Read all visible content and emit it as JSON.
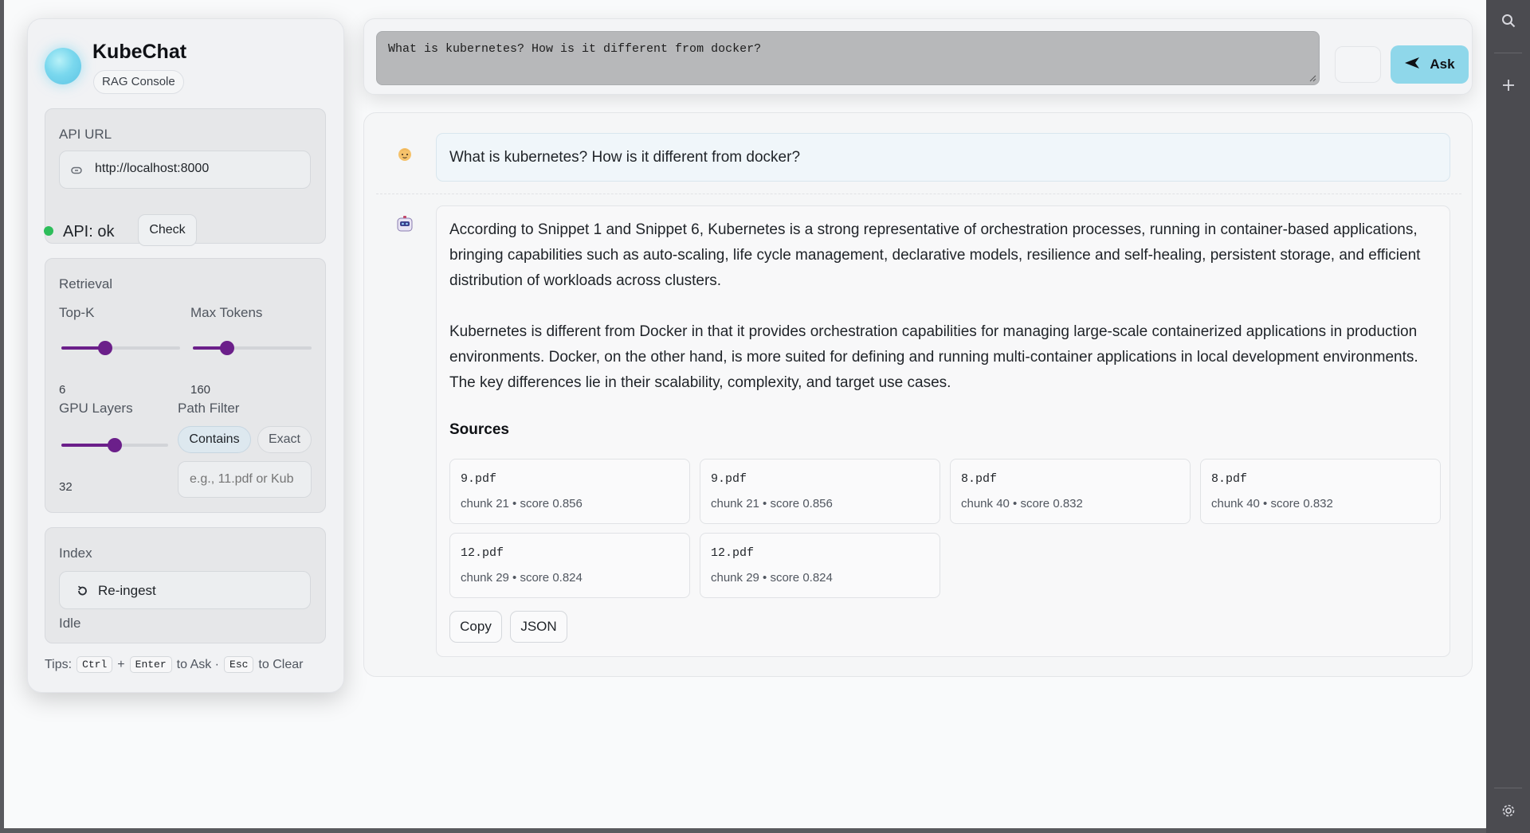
{
  "app": {
    "title": "KubeChat",
    "subtitle": "RAG Console"
  },
  "api": {
    "label": "API URL",
    "url": "http://localhost:8000",
    "status_text": "API: ok",
    "status_color": "#2dbd5a",
    "check_label": "Check"
  },
  "retrieval": {
    "title": "Retrieval",
    "top_k": {
      "label": "Top-K",
      "value": "6",
      "fraction": 0.35
    },
    "max_tokens": {
      "label": "Max Tokens",
      "value": "160",
      "fraction": 0.26
    },
    "gpu_layers": {
      "label": "GPU Layers",
      "value": "32",
      "fraction": 0.5
    },
    "path_filter": {
      "label": "Path Filter",
      "modes": [
        "Contains",
        "Exact"
      ],
      "active_mode": "Contains",
      "placeholder": "e.g., 11.pdf or Kub"
    }
  },
  "index": {
    "title": "Index",
    "reingest_label": "Re-ingest",
    "status": "Idle"
  },
  "tips": {
    "prefix": "Tips:",
    "key_ctrl": "Ctrl",
    "plus": "+",
    "key_enter": "Enter",
    "ask_text": "to Ask ·",
    "key_esc": "Esc",
    "clear_text": "to Clear"
  },
  "query": {
    "text": "What is kubernetes? How is it different from docker?",
    "ask_label": "Ask"
  },
  "chat": {
    "user_message": "What is kubernetes? How is it different from docker?",
    "answer_paragraphs": [
      "According to Snippet 1 and Snippet 6, Kubernetes is a strong representative of orchestration processes, running in container-based applications, bringing capabilities such as auto-scaling, life cycle management, declarative models, resilience and self-healing, persistent storage, and efficient distribution of workloads across clusters.",
      "Kubernetes is different from Docker in that it provides orchestration capabilities for managing large-scale containerized applications in production environments. Docker, on the other hand, is more suited for defining and running multi-container applications in local development environments. The key differences lie in their scalability, complexity, and target use cases."
    ],
    "sources_title": "Sources",
    "sources": [
      {
        "file": "9.pdf",
        "meta": "chunk 21 • score 0.856"
      },
      {
        "file": "9.pdf",
        "meta": "chunk 21 • score 0.856"
      },
      {
        "file": "8.pdf",
        "meta": "chunk 40 • score 0.832"
      },
      {
        "file": "8.pdf",
        "meta": "chunk 40 • score 0.832"
      },
      {
        "file": "12.pdf",
        "meta": "chunk 29 • score 0.824"
      },
      {
        "file": "12.pdf",
        "meta": "chunk 29 • score 0.824"
      }
    ],
    "copy_label": "Copy",
    "json_label": "JSON"
  },
  "icons": {
    "logo": "gradient-orb",
    "api_url": "link-icon",
    "reingest": "refresh-icon",
    "ask": "send-icon",
    "user_avatar": "person-emoji",
    "bot_avatar": "robot-emoji",
    "right_strip": [
      "search-icon",
      "plus-icon",
      "settings-icon"
    ]
  },
  "colors": {
    "accent": "#6b1f8a",
    "ask_button": "#8fd7ea",
    "status_ok": "#2dbd5a"
  }
}
